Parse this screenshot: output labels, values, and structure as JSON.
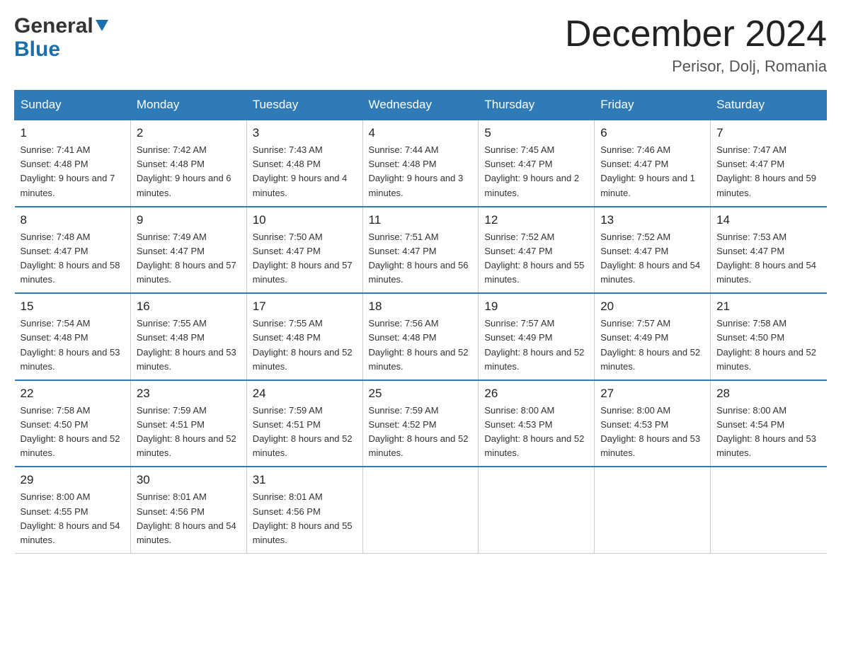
{
  "header": {
    "logo_general": "General",
    "logo_blue": "Blue",
    "month_title": "December 2024",
    "location": "Perisor, Dolj, Romania"
  },
  "days_of_week": [
    "Sunday",
    "Monday",
    "Tuesday",
    "Wednesday",
    "Thursday",
    "Friday",
    "Saturday"
  ],
  "weeks": [
    [
      {
        "day": "1",
        "sunrise": "7:41 AM",
        "sunset": "4:48 PM",
        "daylight": "9 hours and 7 minutes."
      },
      {
        "day": "2",
        "sunrise": "7:42 AM",
        "sunset": "4:48 PM",
        "daylight": "9 hours and 6 minutes."
      },
      {
        "day": "3",
        "sunrise": "7:43 AM",
        "sunset": "4:48 PM",
        "daylight": "9 hours and 4 minutes."
      },
      {
        "day": "4",
        "sunrise": "7:44 AM",
        "sunset": "4:48 PM",
        "daylight": "9 hours and 3 minutes."
      },
      {
        "day": "5",
        "sunrise": "7:45 AM",
        "sunset": "4:47 PM",
        "daylight": "9 hours and 2 minutes."
      },
      {
        "day": "6",
        "sunrise": "7:46 AM",
        "sunset": "4:47 PM",
        "daylight": "9 hours and 1 minute."
      },
      {
        "day": "7",
        "sunrise": "7:47 AM",
        "sunset": "4:47 PM",
        "daylight": "8 hours and 59 minutes."
      }
    ],
    [
      {
        "day": "8",
        "sunrise": "7:48 AM",
        "sunset": "4:47 PM",
        "daylight": "8 hours and 58 minutes."
      },
      {
        "day": "9",
        "sunrise": "7:49 AM",
        "sunset": "4:47 PM",
        "daylight": "8 hours and 57 minutes."
      },
      {
        "day": "10",
        "sunrise": "7:50 AM",
        "sunset": "4:47 PM",
        "daylight": "8 hours and 57 minutes."
      },
      {
        "day": "11",
        "sunrise": "7:51 AM",
        "sunset": "4:47 PM",
        "daylight": "8 hours and 56 minutes."
      },
      {
        "day": "12",
        "sunrise": "7:52 AM",
        "sunset": "4:47 PM",
        "daylight": "8 hours and 55 minutes."
      },
      {
        "day": "13",
        "sunrise": "7:52 AM",
        "sunset": "4:47 PM",
        "daylight": "8 hours and 54 minutes."
      },
      {
        "day": "14",
        "sunrise": "7:53 AM",
        "sunset": "4:47 PM",
        "daylight": "8 hours and 54 minutes."
      }
    ],
    [
      {
        "day": "15",
        "sunrise": "7:54 AM",
        "sunset": "4:48 PM",
        "daylight": "8 hours and 53 minutes."
      },
      {
        "day": "16",
        "sunrise": "7:55 AM",
        "sunset": "4:48 PM",
        "daylight": "8 hours and 53 minutes."
      },
      {
        "day": "17",
        "sunrise": "7:55 AM",
        "sunset": "4:48 PM",
        "daylight": "8 hours and 52 minutes."
      },
      {
        "day": "18",
        "sunrise": "7:56 AM",
        "sunset": "4:48 PM",
        "daylight": "8 hours and 52 minutes."
      },
      {
        "day": "19",
        "sunrise": "7:57 AM",
        "sunset": "4:49 PM",
        "daylight": "8 hours and 52 minutes."
      },
      {
        "day": "20",
        "sunrise": "7:57 AM",
        "sunset": "4:49 PM",
        "daylight": "8 hours and 52 minutes."
      },
      {
        "day": "21",
        "sunrise": "7:58 AM",
        "sunset": "4:50 PM",
        "daylight": "8 hours and 52 minutes."
      }
    ],
    [
      {
        "day": "22",
        "sunrise": "7:58 AM",
        "sunset": "4:50 PM",
        "daylight": "8 hours and 52 minutes."
      },
      {
        "day": "23",
        "sunrise": "7:59 AM",
        "sunset": "4:51 PM",
        "daylight": "8 hours and 52 minutes."
      },
      {
        "day": "24",
        "sunrise": "7:59 AM",
        "sunset": "4:51 PM",
        "daylight": "8 hours and 52 minutes."
      },
      {
        "day": "25",
        "sunrise": "7:59 AM",
        "sunset": "4:52 PM",
        "daylight": "8 hours and 52 minutes."
      },
      {
        "day": "26",
        "sunrise": "8:00 AM",
        "sunset": "4:53 PM",
        "daylight": "8 hours and 52 minutes."
      },
      {
        "day": "27",
        "sunrise": "8:00 AM",
        "sunset": "4:53 PM",
        "daylight": "8 hours and 53 minutes."
      },
      {
        "day": "28",
        "sunrise": "8:00 AM",
        "sunset": "4:54 PM",
        "daylight": "8 hours and 53 minutes."
      }
    ],
    [
      {
        "day": "29",
        "sunrise": "8:00 AM",
        "sunset": "4:55 PM",
        "daylight": "8 hours and 54 minutes."
      },
      {
        "day": "30",
        "sunrise": "8:01 AM",
        "sunset": "4:56 PM",
        "daylight": "8 hours and 54 minutes."
      },
      {
        "day": "31",
        "sunrise": "8:01 AM",
        "sunset": "4:56 PM",
        "daylight": "8 hours and 55 minutes."
      },
      null,
      null,
      null,
      null
    ]
  ]
}
